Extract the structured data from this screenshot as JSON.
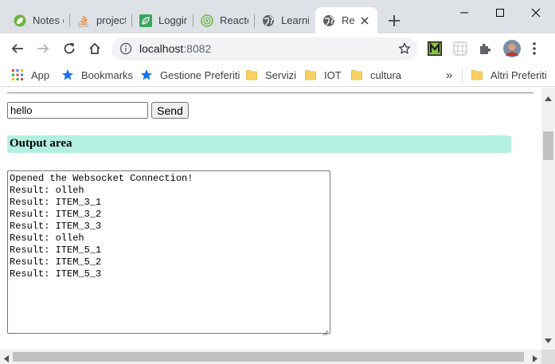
{
  "browser": {
    "tabs": [
      {
        "title": "Notes c",
        "icon": "spring-leaf-icon",
        "active": false
      },
      {
        "title": "project",
        "icon": "stackoverflow-icon",
        "active": false
      },
      {
        "title": "Loggin",
        "icon": "leaf-icon",
        "active": false
      },
      {
        "title": "Reacto",
        "icon": "reactor-icon",
        "active": false
      },
      {
        "title": "Learnin",
        "icon": "globe-icon",
        "active": false
      },
      {
        "title": "Rea",
        "icon": "globe-icon",
        "active": true
      }
    ],
    "new_tab": "+",
    "window_controls": [
      "minimize",
      "maximize",
      "close"
    ]
  },
  "omnibox": {
    "host": "localhost",
    "port": ":8082"
  },
  "bookmarks": {
    "items": [
      {
        "label": "App",
        "icon": "apps-grid-icon"
      },
      {
        "label": "Bookmarks",
        "icon": "star-icon"
      },
      {
        "label": "Gestione Preferiti",
        "icon": "star-icon"
      },
      {
        "label": "Servizi",
        "icon": "folder-icon"
      },
      {
        "label": "IOT",
        "icon": "folder-icon"
      },
      {
        "label": "cultura",
        "icon": "folder-icon"
      }
    ],
    "overflow": "»",
    "other": {
      "label": "Altri Preferiti",
      "icon": "folder-icon"
    }
  },
  "page": {
    "message_input_value": "hello",
    "send_label": "Send",
    "output_title": "Output area",
    "output_text": "Opened the Websocket Connection!\nResult: olleh\nResult: ITEM_3_1\nResult: ITEM_3_2\nResult: ITEM_3_3\nResult: olleh\nResult: ITEM_5_1\nResult: ITEM_5_2\nResult: ITEM_5_3"
  },
  "colors": {
    "output_header_bg": "#b3f0e0",
    "tabstrip_bg": "#dee1e6",
    "google_blue": "#1a73e8",
    "folder_yellow": "#f9d162"
  }
}
